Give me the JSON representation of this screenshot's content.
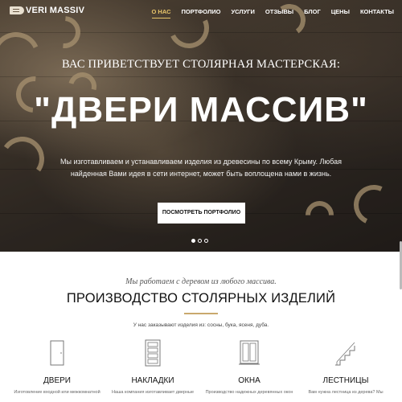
{
  "brand": {
    "logo_text": "VERI MASSIV"
  },
  "nav": {
    "items": [
      {
        "label": "О НАС",
        "active": true
      },
      {
        "label": "ПОРТФОЛИО",
        "active": false
      },
      {
        "label": "УСЛУГИ",
        "active": false
      },
      {
        "label": "ОТЗЫВЫ",
        "active": false
      },
      {
        "label": "БЛОГ",
        "active": false
      },
      {
        "label": "ЦЕНЫ",
        "active": false
      },
      {
        "label": "КОНТАКТЫ",
        "active": false
      }
    ],
    "accent_color": "#e8c56a"
  },
  "hero": {
    "subtitle": "ВАС ПРИВЕТСТВУЕТ СТОЛЯРНАЯ МАСТЕРСКАЯ:",
    "title": "\"ДВЕРИ МАССИВ\"",
    "description": "Мы изготавливаем и устанавливаем изделия из древесины по всему Крыму. Любая найденная Вами идея в сети интернет, может быть воплощена нами в жизнь.",
    "button_label": "ПОСМОТРЕТЬ ПОРТФОЛИО",
    "slides_count": 3,
    "active_slide": 1
  },
  "section": {
    "tagline": "Мы работаем с деревом из любого массива.",
    "title": "ПРОИЗВОДСТВО СТОЛЯРНЫХ ИЗДЕЛИЙ",
    "note": "У нас заказывают изделия из: сосны, бука, ясеня, дуба.",
    "divider_color": "#c9a96e"
  },
  "services": [
    {
      "icon": "door-icon",
      "name": "ДВЕРИ",
      "description": "Изготовление входной или межкомнатной двери"
    },
    {
      "icon": "door-panels-icon",
      "name": "НАКЛАДКИ",
      "description": "Наша компания изготавливает дверные накладки"
    },
    {
      "icon": "window-icon",
      "name": "ОКНА",
      "description": "Производство надежных деревянных окон в"
    },
    {
      "icon": "stairs-icon",
      "name": "ЛЕСТНИЦЫ",
      "description": "Вам нужна лестница из дерева? Мы изготовим"
    }
  ]
}
